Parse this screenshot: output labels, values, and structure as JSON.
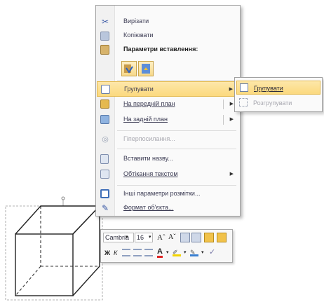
{
  "menu": {
    "cut": "Вирізати",
    "copy": "Копіювати",
    "paste_options": "Параметри вставлення:",
    "group": "Групувати",
    "bring_front": "На передній план",
    "send_back": "На задній план",
    "hyperlink": "Гіперпосилання...",
    "insert_caption": "Вставити назву...",
    "wrap_text": "Обтікання текстом",
    "more_layout": "Інші параметри розмітки...",
    "format_object": "Формат об'єкта..."
  },
  "submenu": {
    "group": "Групувати",
    "ungroup": "Розгрупувати"
  },
  "mini_toolbar": {
    "font": "Cambria",
    "size": "16",
    "grow": "Aˆ",
    "shrink": "Aˇ",
    "bold": "Ж",
    "italic": "К",
    "font_color_letter": "A"
  },
  "colors": {
    "highlight": "#fbd97e",
    "highlight_border": "#e3b84a",
    "disabled_text": "#a8a8b0"
  }
}
